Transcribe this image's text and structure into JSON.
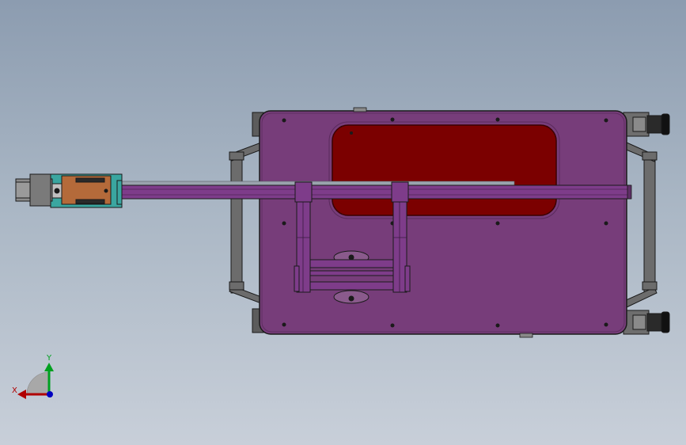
{
  "viewport": {
    "background_top": "#8c9cb0",
    "background_bottom": "#c8cfd9"
  },
  "model": {
    "plate_color": "#773d7a",
    "window_color": "#7b0000",
    "rail_color": "#7e3c8a",
    "frame_color": "#6c6c6c",
    "clamp_color": "#b46a3a",
    "clamp_accent": "#3aa6a0",
    "outline_color": "#1a1a1a"
  },
  "triad": {
    "x_label": "X",
    "y_label": "Y",
    "x_color": "#b00000",
    "y_color": "#00a020",
    "z_color": "#0000c0",
    "icons": [
      "x-axis-arrow-icon",
      "y-axis-arrow-icon",
      "z-axis-dot-icon"
    ]
  }
}
